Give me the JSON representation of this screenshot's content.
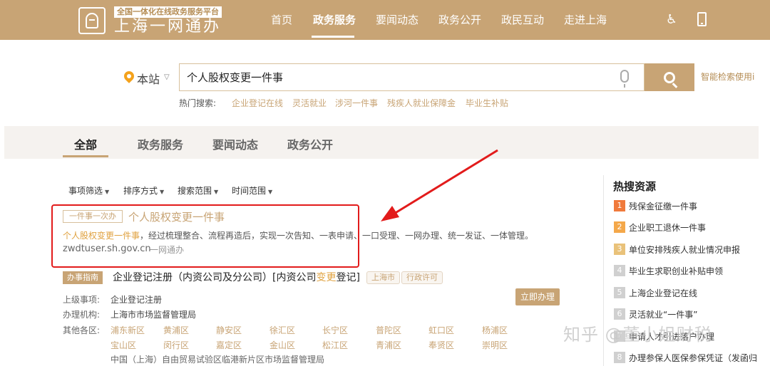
{
  "header": {
    "platform_tag": "全国一体化在线政务服务平台",
    "brand": "上海一网通办",
    "nav": [
      "首页",
      "政务服务",
      "要闻动态",
      "政务公开",
      "政民互动",
      "走进上海"
    ],
    "accessibility_icon": "wheelchair-icon",
    "phone_icon": "mobile-icon"
  },
  "search": {
    "scope": "本站",
    "query": "个人股权变更一件事",
    "smart_link": "智能检索使用i",
    "hot_label": "热门搜索:",
    "hot_items": [
      "企业登记在线",
      "灵活就业",
      "涉河一件事",
      "残疾人就业保障金",
      "毕业生补贴"
    ]
  },
  "tabs": [
    "全部",
    "政务服务",
    "要闻动态",
    "政务公开"
  ],
  "filters": [
    "事项筛选",
    "排序方式",
    "搜索范围",
    "时间范围"
  ],
  "result1": {
    "tag": "一件事一次办",
    "title": "个人股权变更一件事",
    "desc_highlight": "个人股权变更一件事",
    "desc_rest": "，经过梳理整合、流程再造后，实现一次告知、一表申请、一口受理、一网办理、统一发证、一体管理。",
    "url": "zwdtuser.sh.gov.cn",
    "source": "一网通办"
  },
  "result2": {
    "tag": "办事指南",
    "title_before": "企业登记注册（内资公司及分公司）[内资公司",
    "title_highlight": "变更",
    "title_after": "登记]",
    "chips": [
      "上海市",
      "行政许可"
    ],
    "parent_label": "上级事项:",
    "parent_value": "企业登记注册",
    "org_label": "办理机构:",
    "org_value": "上海市市场监督管理局",
    "other_label": "其他各区:",
    "districts_row1": [
      "浦东新区",
      "黄浦区",
      "静安区",
      "徐汇区",
      "长宁区",
      "普陀区",
      "虹口区",
      "杨浦区"
    ],
    "districts_row2": [
      "宝山区",
      "闵行区",
      "嘉定区",
      "金山区",
      "松江区",
      "青浦区",
      "奉贤区",
      "崇明区"
    ],
    "zone": "中国（上海）自由贸易试验区临港新片区市场监督管理局",
    "action": "立即办理"
  },
  "sidebar": {
    "title": "热搜资源",
    "items": [
      {
        "rank": "1",
        "text": "残保金征缴一件事",
        "color": "#f07a3c"
      },
      {
        "rank": "2",
        "text": "企业职工退休一件事",
        "color": "#f4a84a"
      },
      {
        "rank": "3",
        "text": "单位安排残疾人就业情况申报",
        "color": "#e9c27a"
      },
      {
        "rank": "4",
        "text": "毕业生求职创业补贴申领",
        "color": "#d0d0d0"
      },
      {
        "rank": "5",
        "text": "上海企业登记在线",
        "color": "#d0d0d0"
      },
      {
        "rank": "6",
        "text": "灵活就业“一件事”",
        "color": "#d0d0d0"
      },
      {
        "rank": "7",
        "text": "申请人才引进落户办理",
        "color": "#d0d0d0"
      },
      {
        "rank": "8",
        "text": "办理参保人医保参保凭证（发函归",
        "color": "#d0d0d0"
      }
    ]
  },
  "watermark": "知乎 @董小姐财税",
  "colors": {
    "brand": "#c8a475",
    "annotation": "#e21b1b"
  }
}
